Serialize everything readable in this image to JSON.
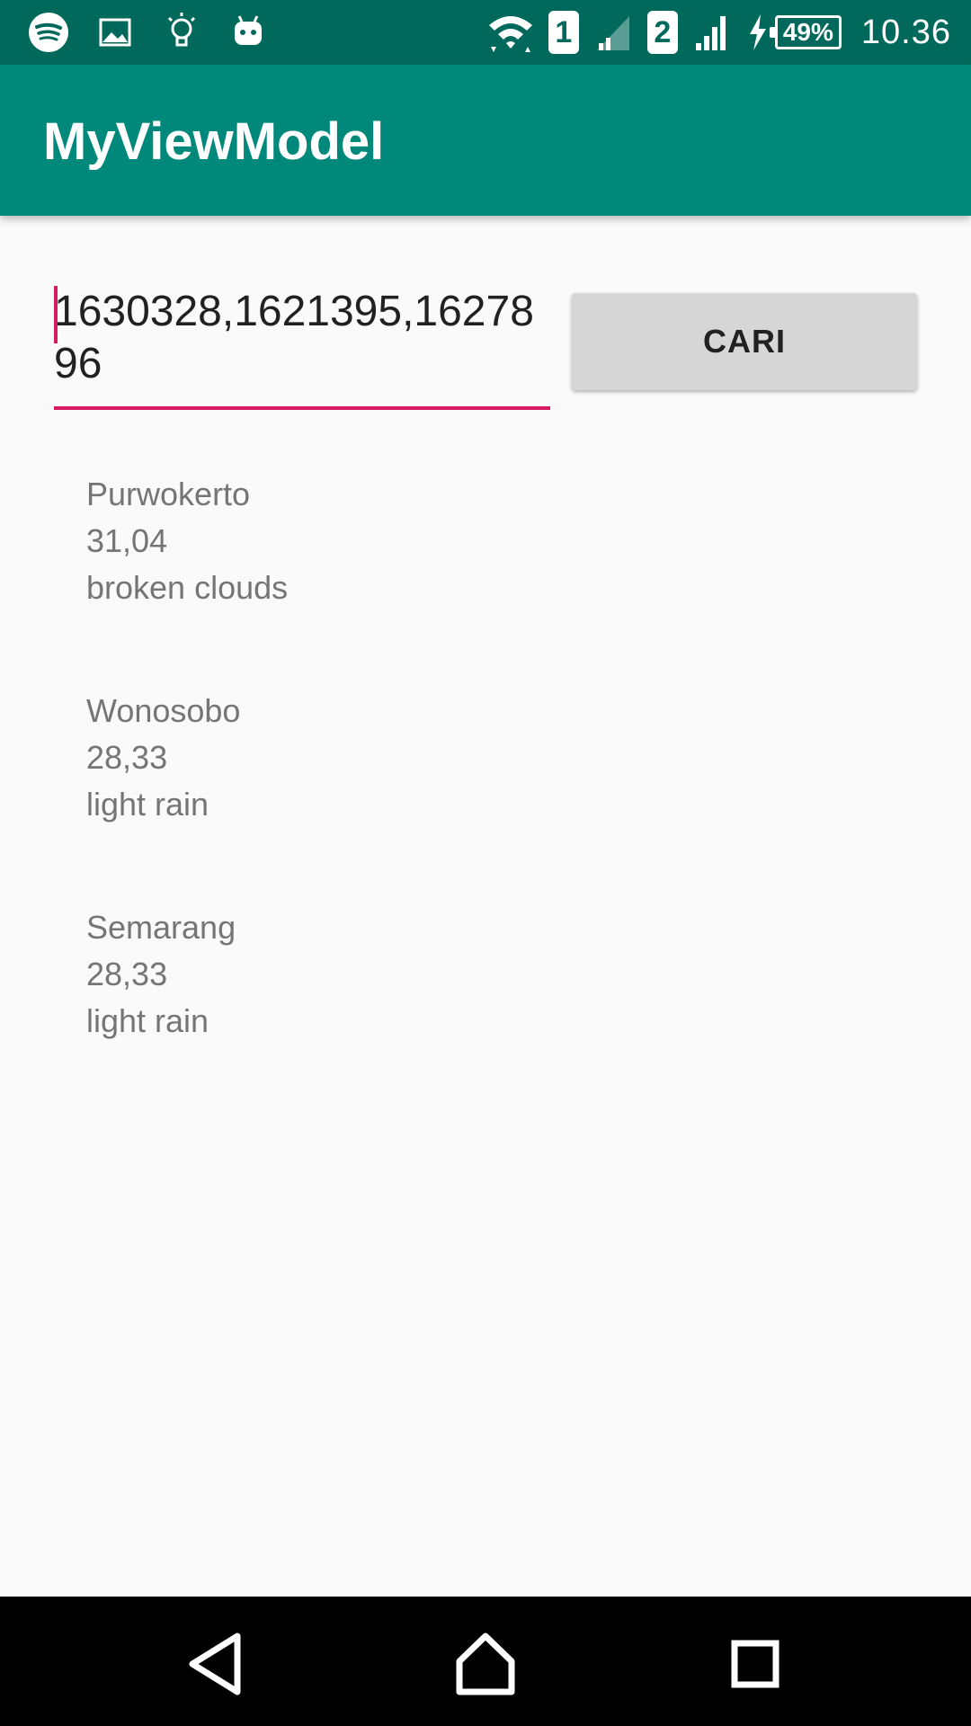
{
  "status_bar": {
    "left_icons": [
      "spotify-icon",
      "image-icon",
      "lightbulb-icon",
      "android-icon"
    ],
    "sim1_label": "1",
    "sim2_label": "2",
    "battery_percent": "49%",
    "time": "10.36"
  },
  "app_bar": {
    "title": "MyViewModel"
  },
  "search": {
    "input_value": "1630328,1621395,1627896",
    "button_label": "CARI"
  },
  "cities": [
    {
      "name": "Purwokerto",
      "temp": "31,04",
      "desc": "broken clouds"
    },
    {
      "name": "Wonosobo",
      "temp": "28,33",
      "desc": "light rain"
    },
    {
      "name": "Semarang",
      "temp": "28,33",
      "desc": "light rain"
    }
  ],
  "nav_bar": {
    "icons": [
      "back-icon",
      "home-icon",
      "recents-icon"
    ]
  },
  "colors": {
    "status_bar": "#00695c",
    "app_bar": "#00897b",
    "accent": "#d81b60",
    "button": "#d6d6d6"
  }
}
